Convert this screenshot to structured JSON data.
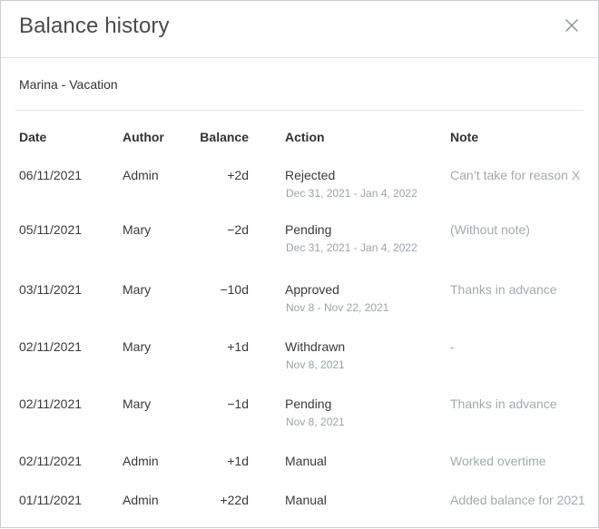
{
  "dialog": {
    "title": "Balance history",
    "subtitle": "Marina - Vacation",
    "close_icon": "close-icon"
  },
  "table": {
    "headers": {
      "date": "Date",
      "author": "Author",
      "balance": "Balance",
      "action": "Action",
      "note": "Note"
    },
    "rows": [
      {
        "date": "06/11/2021",
        "author": "Admin",
        "balance": "+2d",
        "action": "Rejected",
        "period": "Dec 31, 2021 - Jan 4, 2022",
        "note": "Can’t take for reason X"
      },
      {
        "date": "05/11/2021",
        "author": "Mary",
        "balance": "−2d",
        "action": "Pending",
        "period": "Dec 31, 2021 - Jan 4, 2022",
        "note": "(Without note)"
      },
      {
        "date": "03/11/2021",
        "author": "Mary",
        "balance": "−10d",
        "action": "Approved",
        "period": "Nov 8 - Nov 22, 2021",
        "note": "Thanks in advance"
      },
      {
        "date": "02/11/2021",
        "author": "Mary",
        "balance": "+1d",
        "action": "Withdrawn",
        "period": "Nov 8, 2021",
        "note": "-"
      },
      {
        "date": "02/11/2021",
        "author": "Mary",
        "balance": "−1d",
        "action": "Pending",
        "period": "Nov 8, 2021",
        "note": "Thanks in advance"
      },
      {
        "date": "02/11/2021",
        "author": "Admin",
        "balance": "+1d",
        "action": "Manual",
        "period": "",
        "note": "Worked overtime"
      },
      {
        "date": "01/11/2021",
        "author": "Admin",
        "balance": "+22d",
        "action": "Manual",
        "period": "",
        "note": "Added balance for 2021"
      }
    ]
  }
}
